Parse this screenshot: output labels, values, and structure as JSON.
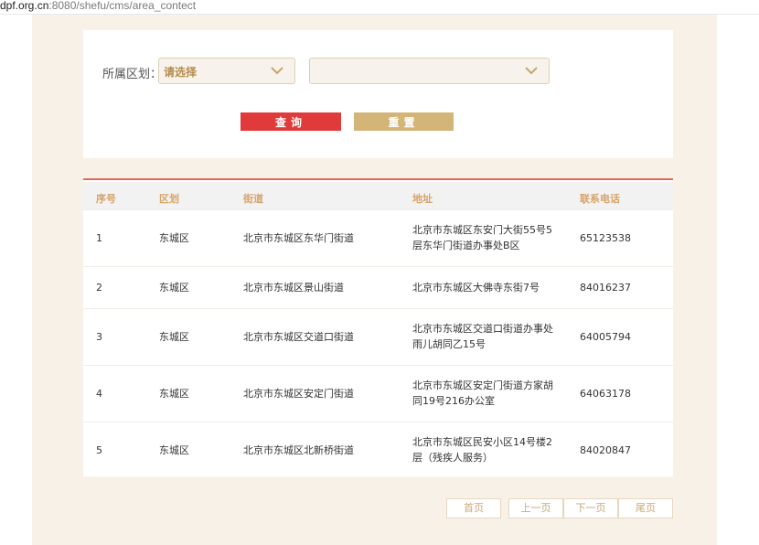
{
  "browser": {
    "url_host": "dpf.org.cn",
    "url_rest": ":8080/shefu/cms/area_contect"
  },
  "filter": {
    "region_label": "所属区划：",
    "district_select": "请选择",
    "street_select": "",
    "query_button": "查询",
    "reset_button": "重置"
  },
  "table": {
    "headers": [
      "序号",
      "区划",
      "街道",
      "地址",
      "联系电话"
    ],
    "rows": [
      {
        "no": "1",
        "district": "东城区",
        "street": "北京市东城区东华门街道",
        "address_line1": "北京市东城区东安门大街55号5",
        "address_line2": "层东华门街道办事处B区",
        "phone": "65123538"
      },
      {
        "no": "2",
        "district": "东城区",
        "street": "北京市东城区景山街道",
        "address_line1": "北京市东城区大佛寺东街7号",
        "address_line2": "",
        "phone": "84016237"
      },
      {
        "no": "3",
        "district": "东城区",
        "street": "北京市东城区交道口街道",
        "address_line1": "北京市东城区交道口街道办事处",
        "address_line2": "雨儿胡同乙15号",
        "phone": "64005794"
      },
      {
        "no": "4",
        "district": "东城区",
        "street": "北京市东城区安定门街道",
        "address_line1": "北京市东城区安定门街道方家胡",
        "address_line2": "同19号216办公室",
        "phone": "64063178"
      },
      {
        "no": "5",
        "district": "东城区",
        "street": "北京市东城区北新桥街道",
        "address_line1": "北京市东城区民安小区14号楼2",
        "address_line2": "层（残疾人服务）",
        "phone": "84020847"
      }
    ]
  },
  "pager": {
    "first": "首页",
    "prev": "上一页",
    "next": "下一页",
    "last": "尾页"
  },
  "icons": {
    "select_arrow": "chevron-down-icon"
  },
  "colors": {
    "page_bg": "#f8f1e7",
    "query": "#e03a3a",
    "reset": "#d4b578",
    "header_text": "#d6a46a",
    "accent_line": "#e06a5e"
  }
}
